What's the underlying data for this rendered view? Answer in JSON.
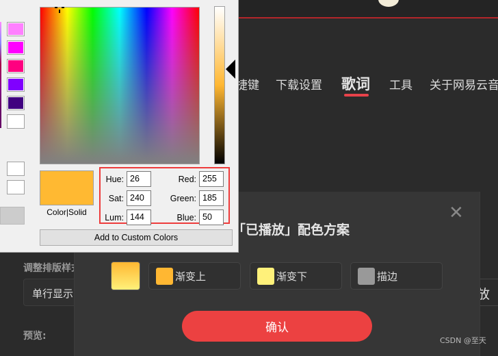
{
  "header": {
    "nav": [
      {
        "label": "捷键"
      },
      {
        "label": "下载设置"
      },
      {
        "label": "歌词",
        "active": true
      },
      {
        "label": "工具"
      },
      {
        "label": "关于网易云音"
      }
    ]
  },
  "settings": {
    "layout_label": "调整排版样式",
    "layout_value": "单行显示",
    "preview_label": "预览:",
    "right_text": "放"
  },
  "modal": {
    "title": "「已播放」配色方案",
    "preview_colors": [
      "#ffb732",
      "#fff17a"
    ],
    "options": [
      {
        "label": "渐变上",
        "color": "#ffb732"
      },
      {
        "label": "渐变下",
        "color": "#fff17a"
      },
      {
        "label": "描边",
        "color": "#999999"
      }
    ],
    "confirm_label": "确认"
  },
  "color_dialog": {
    "basic_colors": [
      "#ff80ff",
      "#ff00ff",
      "#ff0080",
      "#8000ff",
      "#400080",
      "#ffffff"
    ],
    "custom_colors": [
      "#ffffff",
      "#ffffff"
    ],
    "color_solid_label": "Color|Solid",
    "current_color": "#ffb932",
    "fields": {
      "hue_label": "Hue:",
      "hue": "26",
      "sat_label": "Sat:",
      "sat": "240",
      "lum_label": "Lum:",
      "lum": "144",
      "red_label": "Red:",
      "red": "255",
      "green_label": "Green:",
      "green": "185",
      "blue_label": "Blue:",
      "blue": "50"
    },
    "add_custom_label": "Add to Custom Colors"
  },
  "watermark": "CSDN @至天"
}
